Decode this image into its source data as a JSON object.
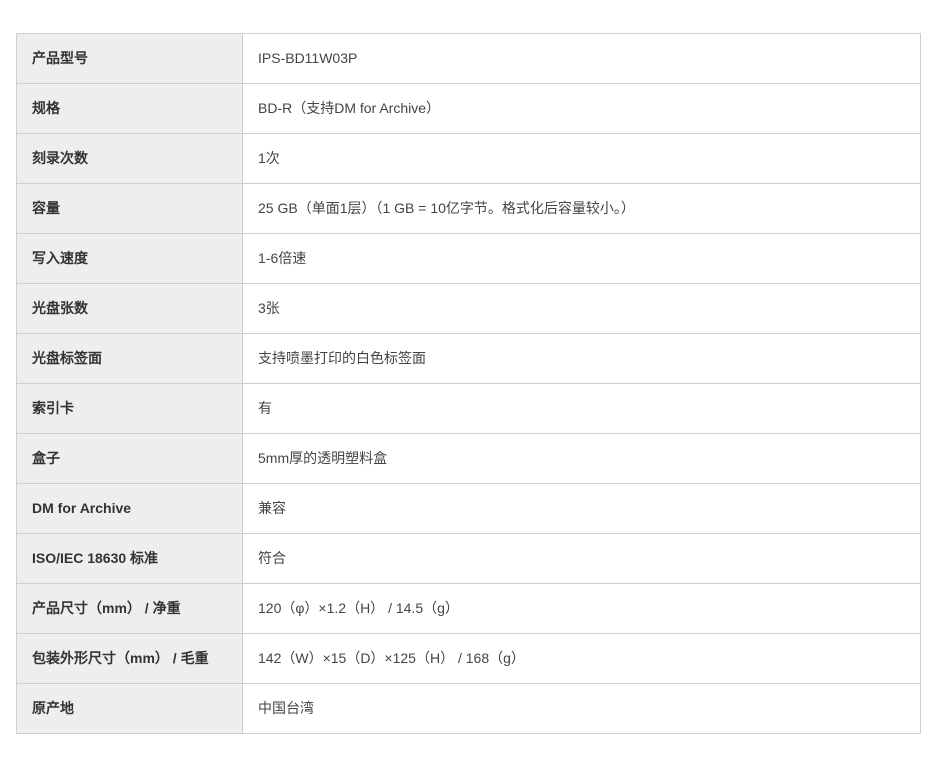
{
  "specs": [
    {
      "label": "产品型号",
      "value": "IPS-BD11W03P"
    },
    {
      "label": "规格",
      "value": "BD-R（支持DM for Archive）"
    },
    {
      "label": "刻录次数",
      "value": "1次"
    },
    {
      "label": "容量",
      "value": "25 GB（单面1层）（1 GB = 10亿字节。格式化后容量较小。）"
    },
    {
      "label": "写入速度",
      "value": "1-6倍速"
    },
    {
      "label": "光盘张数",
      "value": "3张"
    },
    {
      "label": "光盘标签面",
      "value": "支持喷墨打印的白色标签面"
    },
    {
      "label": "索引卡",
      "value": "有"
    },
    {
      "label": "盒子",
      "value": "5mm厚的透明塑料盒"
    },
    {
      "label": "DM for Archive",
      "value": "兼容"
    },
    {
      "label": "ISO/IEC 18630 标准",
      "value": "符合"
    },
    {
      "label": "产品尺寸（mm） / 净重",
      "value": "120（φ）×1.2（H） / 14.5（g）"
    },
    {
      "label": "包装外形尺寸（mm） / 毛重",
      "value": "142（W）×15（D）×125（H） / 168（g）"
    },
    {
      "label": "原产地",
      "value": "中国台湾"
    }
  ]
}
